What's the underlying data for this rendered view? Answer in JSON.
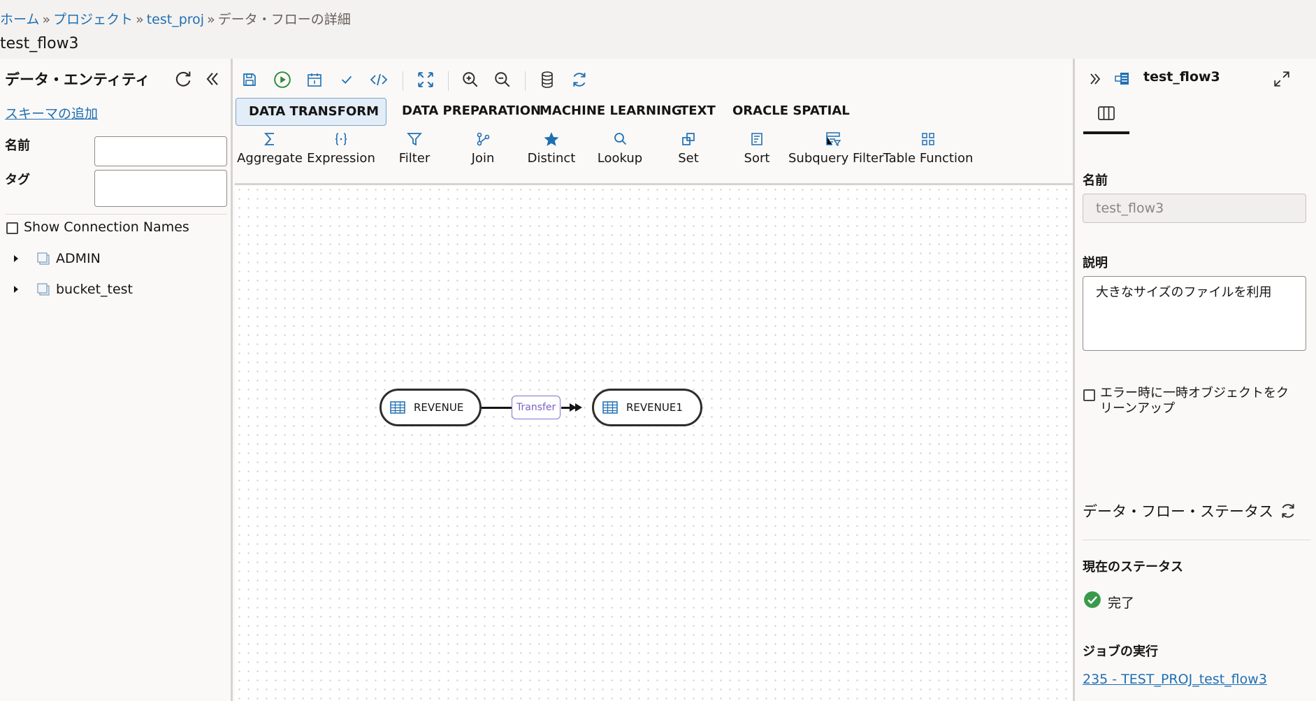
{
  "breadcrumb": {
    "home": "ホーム",
    "sep1": "»",
    "project": "プロジェクト",
    "sep2": "»",
    "proj_name": "test_proj",
    "sep3": "»",
    "current": "データ・フローの詳細"
  },
  "page_title": "test_flow3",
  "left_panel": {
    "title": "データ・エンティティ",
    "add_schema": "スキーマの追加",
    "name_label": "名前",
    "name_value": "",
    "tag_label": "タグ",
    "tag_value": "",
    "show_connections": "Show Connection Names",
    "tree": [
      {
        "label": "ADMIN"
      },
      {
        "label": "bucket_test"
      }
    ]
  },
  "category_tabs": [
    {
      "label": "DATA TRANSFORM",
      "active": true
    },
    {
      "label": "DATA PREPARATION",
      "active": false
    },
    {
      "label": "MACHINE LEARNING",
      "active": false
    },
    {
      "label": "TEXT",
      "active": false
    },
    {
      "label": "ORACLE SPATIAL",
      "active": false
    }
  ],
  "operators": [
    {
      "label": "Aggregate",
      "icon": "sigma-icon"
    },
    {
      "label": "Expression",
      "icon": "braces-icon"
    },
    {
      "label": "Filter",
      "icon": "filter-icon"
    },
    {
      "label": "Join",
      "icon": "join-icon"
    },
    {
      "label": "Distinct",
      "icon": "star-icon"
    },
    {
      "label": "Lookup",
      "icon": "search-icon"
    },
    {
      "label": "Set",
      "icon": "set-icon"
    },
    {
      "label": "Sort",
      "icon": "sort-icon"
    },
    {
      "label": "Subquery Filter",
      "icon": "subquery-filter-icon"
    },
    {
      "label": "Table Function",
      "icon": "table-function-icon"
    }
  ],
  "flow": {
    "source": "REVENUE",
    "edge_label": "Transfer",
    "target": "REVENUE1"
  },
  "right_panel": {
    "title": "test_flow3",
    "name_label": "名前",
    "name_value": "test_flow3",
    "desc_label": "説明",
    "desc_value": "大きなサイズのファイルを利用",
    "cleanup_label_line1": "エラー時に一時オブジェクトをク",
    "cleanup_label_line2": "リーンアップ",
    "status_section": "データ・フロー・ステータス",
    "current_status_label": "現在のステータス",
    "current_status": "完了",
    "job_label": "ジョブの実行",
    "job_link": "235 - TEST_PROJ_test_flow3"
  },
  "colors": {
    "accent_blue": "#1f6fb2",
    "run_green": "#2e8b3a",
    "success_green": "#3a9a4a",
    "edge_label_purple": "#7d5ec2"
  }
}
